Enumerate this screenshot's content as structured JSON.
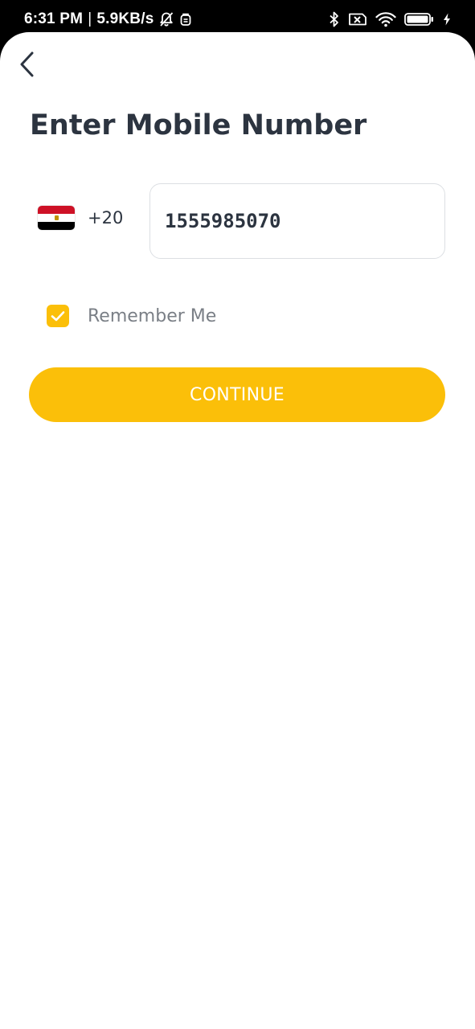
{
  "status_bar": {
    "time": "6:31 PM",
    "separator": "|",
    "network_speed": "5.9KB/s",
    "icons": [
      "bell-off-icon",
      "notification-icon",
      "bluetooth-icon",
      "no-sim-icon",
      "wifi-icon",
      "battery-icon",
      "charging-icon"
    ]
  },
  "header": {
    "back_icon": "chevron-left-icon",
    "title": "Enter Mobile Number"
  },
  "phone": {
    "country_flag": "egypt-flag-icon",
    "dial_code": "+20",
    "number": "1555985070"
  },
  "remember_me": {
    "label": "Remember Me",
    "checked": true
  },
  "continue": {
    "label": "CONTINUE"
  },
  "colors": {
    "accent": "#fbbf09",
    "title_text": "#2c3440",
    "muted_text": "#7a7f86",
    "field_border": "#dcdfe3",
    "flag_red": "#ce1126",
    "flag_white": "#ffffff",
    "flag_black": "#000000"
  }
}
